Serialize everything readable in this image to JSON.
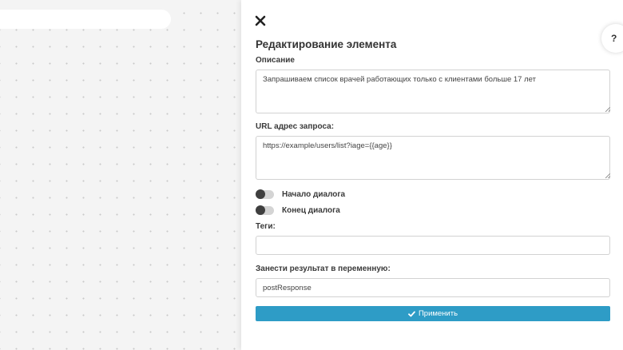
{
  "panel": {
    "title": "Редактирование элемента",
    "help_label": "?",
    "close_icon": "close-icon",
    "description": {
      "label": "Описание",
      "value": "Запрашиваем список врачей работающих только с клиентами больше 17 лет"
    },
    "url": {
      "label": "URL адрес запроса:",
      "value": "https://example/users/list?iage={{age}}"
    },
    "toggles": {
      "start_label": "Начало диалога",
      "end_label": "Конец диалога"
    },
    "tags": {
      "label": "Теги:",
      "value": ""
    },
    "result_var": {
      "label": "Занести результат в переменную:",
      "value": "postResponse"
    },
    "apply_label": "Применить",
    "apply_icon": "check-icon"
  },
  "colors": {
    "accent": "#2e9cc6",
    "toggle_track": "#d4d4d4",
    "toggle_knob": "#3f3f3f"
  }
}
